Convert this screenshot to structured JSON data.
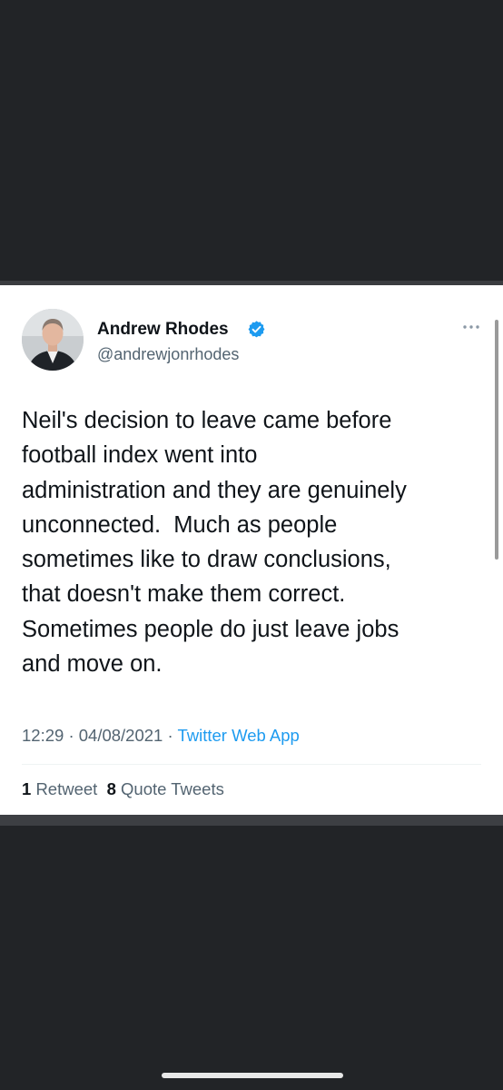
{
  "tweet": {
    "author_name": "Andrew Rhodes",
    "handle": "@andrewjonrhodes",
    "verified_icon": "verified-badge-icon",
    "more_icon": "more-options-icon",
    "text": "Neil's decision to leave came before\nfootball index went into\nadministration and they are genuinely\nunconnected.  Much as people\nsometimes like to draw conclusions,\nthat doesn't make them correct.\nSometimes people do just leave jobs\nand move on.",
    "time": "12:29",
    "separator": "·",
    "date": "04/08/2021",
    "source": "Twitter Web App",
    "retweet_count": "1",
    "retweet_label": "Retweet",
    "quote_count": "8",
    "quote_label": "Quote Tweets"
  },
  "colors": {
    "background": "#222427",
    "card": "#ffffff",
    "text_primary": "#0f1419",
    "text_secondary": "#536471",
    "accent": "#1d9bf0"
  }
}
